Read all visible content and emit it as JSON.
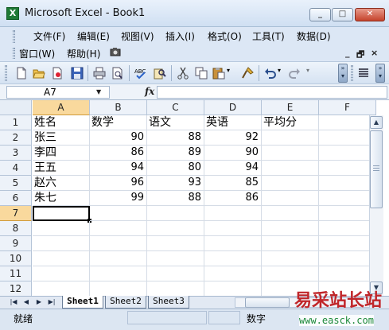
{
  "window": {
    "title": "Microsoft Excel - Book1",
    "minimize": "_",
    "maximize": "□",
    "close": "✕"
  },
  "menu": {
    "items": [
      "文件(F)",
      "编辑(E)",
      "视图(V)",
      "插入(I)",
      "格式(O)",
      "工具(T)",
      "数据(D)"
    ],
    "items_row2": [
      "窗口(W)",
      "帮助(H)"
    ],
    "mdi_controls": [
      "_",
      "🗗",
      "×"
    ]
  },
  "toolbar": {
    "icons": [
      "new-icon",
      "open-icon",
      "permission-icon",
      "save-icon",
      "print-icon",
      "print-preview-icon",
      "spelling-icon",
      "research-icon",
      "cut-icon",
      "copy-icon",
      "paste-icon",
      "format-painter-icon",
      "undo-icon",
      "redo-icon",
      "align-icon"
    ]
  },
  "formula_bar": {
    "name_box": "A7",
    "fx": "fx",
    "formula": ""
  },
  "sheet": {
    "columns": [
      "A",
      "B",
      "C",
      "D",
      "E",
      "F"
    ],
    "rows": [
      "1",
      "2",
      "3",
      "4",
      "5",
      "6",
      "7",
      "8",
      "9",
      "10",
      "11",
      "12"
    ],
    "active_cell": "A7",
    "header": [
      "姓名",
      "数学",
      "语文",
      "英语",
      "平均分"
    ],
    "data": [
      [
        "张三",
        "90",
        "88",
        "92"
      ],
      [
        "李四",
        "86",
        "89",
        "90"
      ],
      [
        "王五",
        "94",
        "80",
        "94"
      ],
      [
        "赵六",
        "96",
        "93",
        "85"
      ],
      [
        "朱七",
        "99",
        "88",
        "86"
      ]
    ]
  },
  "tabs": {
    "nav": [
      "|◀",
      "◀",
      "▶",
      "▶|"
    ],
    "sheets": [
      "Sheet1",
      "Sheet2",
      "Sheet3"
    ],
    "active": "Sheet1"
  },
  "status": {
    "ready": "就绪",
    "num": "数字"
  },
  "watermark": {
    "main": "易采站长站",
    "sub": "www.easck.com"
  },
  "colors": {
    "title_bar": "#cfdff2",
    "menu_bar": "#dce7f5",
    "header_active": "#f9d99d",
    "close_button": "#c5432c",
    "watermark_red": "#c0262a",
    "watermark_green": "#1e8a3a"
  }
}
